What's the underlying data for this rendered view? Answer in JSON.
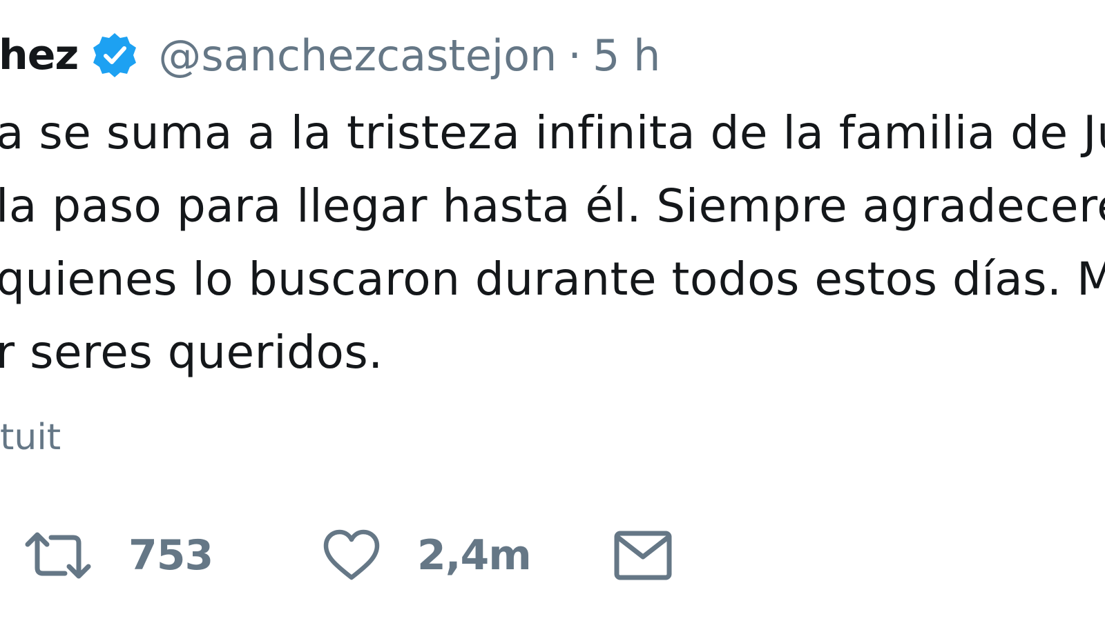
{
  "tweet": {
    "name": "hez",
    "handle": "@sanchezcastejon",
    "separator": "·",
    "time": "5 h",
    "lines": [
      "a se suma a la tristeza  infinita de la familia de Jul",
      "la paso para llegar hasta él. Siempre agradecerem",
      "quienes lo buscaron durante todos estos días. M",
      "r seres queridos."
    ],
    "translate_label": "tuit"
  },
  "actions": {
    "retweet": {
      "icon": "retweet-icon",
      "count": "753"
    },
    "like": {
      "icon": "heart-icon",
      "count": "2,4m"
    },
    "message": {
      "icon": "envelope-icon"
    }
  },
  "colors": {
    "text": "#14171a",
    "secondary": "#657786",
    "verified": "#1da1f2"
  }
}
